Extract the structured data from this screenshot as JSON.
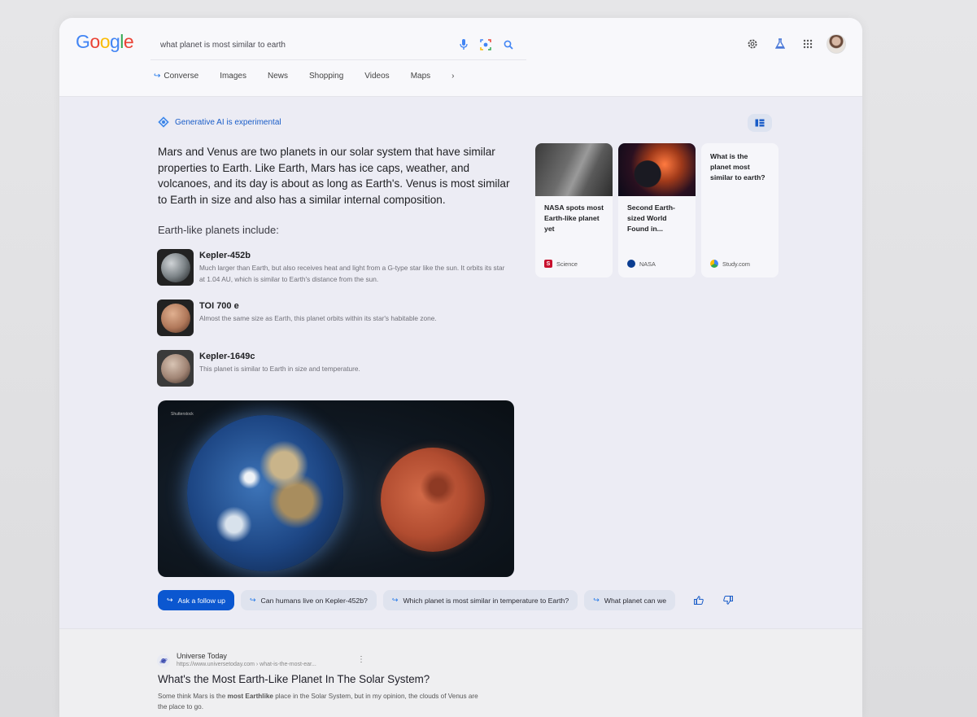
{
  "header": {
    "logo": [
      "G",
      "o",
      "o",
      "g",
      "l",
      "e"
    ],
    "logo_colors": [
      "#4285f4",
      "#ea4335",
      "#fbbc05",
      "#4285f4",
      "#34a853",
      "#ea4335"
    ],
    "search_query": "what planet is most similar to earth",
    "tabs": [
      "Converse",
      "Images",
      "News",
      "Shopping",
      "Videos",
      "Maps"
    ]
  },
  "ai": {
    "badge": "Generative AI is experimental",
    "summary": "Mars and Venus are two planets in our solar system that have similar properties to Earth. Like Earth, Mars has ice caps, weather, and volcanoes, and its day is about as long as Earth's. Venus is most similar to Earth in size and also has a similar internal composition.",
    "subhead": "Earth-like planets include:",
    "planets": [
      {
        "name": "Kepler-452b",
        "desc": "Much larger than Earth, but also receives heat and light from a G-type star like the sun. It orbits its star at 1.04 AU, which is similar to Earth's distance from the sun."
      },
      {
        "name": "TOI 700 e",
        "desc": "Almost the same size as Earth, this planet orbits within its star's habitable zone."
      },
      {
        "name": "Kepler-1649c",
        "desc": "This planet is similar to Earth in size and temperature."
      }
    ],
    "hero_credit": "Shutterstock"
  },
  "sources": [
    {
      "title": "NASA spots most Earth-like planet yet",
      "source": "Science",
      "fav": "S"
    },
    {
      "title": "Second Earth-sized World Found in...",
      "source": "NASA",
      "fav": ""
    },
    {
      "title": "What is the planet most similar to earth?",
      "source": "Study.com",
      "fav": ""
    }
  ],
  "followups": {
    "primary": "Ask a follow up",
    "chips": [
      "Can humans live on Kepler-452b?",
      "Which planet is most similar in temperature to Earth?",
      "What planet can we"
    ]
  },
  "result": {
    "site": "Universe Today",
    "url": "https://www.universetoday.com › what-is-the-most-ear...",
    "title": "What's the Most Earth-Like Planet In The Solar System?",
    "snippet_pre": "Some think Mars is the ",
    "snippet_bold": "most Earthlike",
    "snippet_post": " place in the Solar System, but in my opinion, the clouds of Venus are the place to go."
  }
}
